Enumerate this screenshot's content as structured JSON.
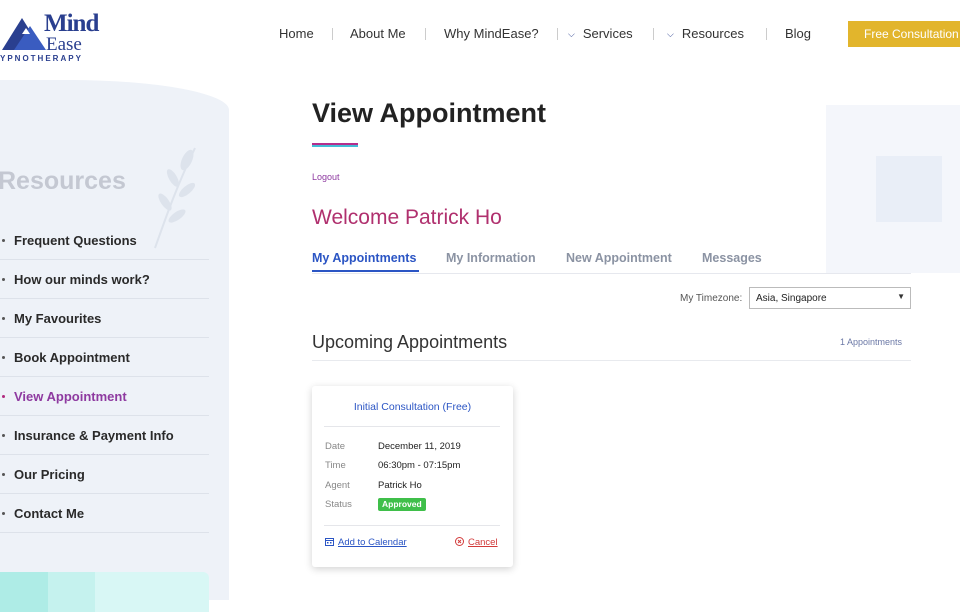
{
  "header": {
    "logo": {
      "line1": "Mind",
      "line2": "Ease",
      "tagline": "YPNOTHERAPY"
    },
    "nav": [
      {
        "label": "Home",
        "has_dropdown": false
      },
      {
        "label": "About Me",
        "has_dropdown": false
      },
      {
        "label": "Why MindEase?",
        "has_dropdown": false
      },
      {
        "label": "Services",
        "has_dropdown": true
      },
      {
        "label": "Resources",
        "has_dropdown": true
      },
      {
        "label": "Blog",
        "has_dropdown": false
      }
    ],
    "cta_label": "Free Consultation"
  },
  "sidebar": {
    "title": "Resources",
    "items": [
      {
        "label": "Frequent Questions",
        "active": false
      },
      {
        "label": "How our minds work?",
        "active": false
      },
      {
        "label": "My Favourites",
        "active": false
      },
      {
        "label": "Book Appointment",
        "active": false
      },
      {
        "label": "View Appointment",
        "active": true
      },
      {
        "label": "Insurance & Payment Info",
        "active": false
      },
      {
        "label": "Our Pricing",
        "active": false
      },
      {
        "label": "Contact Me",
        "active": false
      }
    ]
  },
  "main": {
    "title": "View Appointment",
    "logout_label": "Logout",
    "welcome": "Welcome Patrick Ho",
    "tabs": [
      {
        "label": "My Appointments",
        "active": true
      },
      {
        "label": "My Information",
        "active": false
      },
      {
        "label": "New Appointment",
        "active": false
      },
      {
        "label": "Messages",
        "active": false
      }
    ],
    "timezone": {
      "label": "My Timezone:",
      "value": "Asia, Singapore"
    },
    "upcoming": {
      "heading": "Upcoming Appointments",
      "count_label": "1 Appointments"
    },
    "appointment": {
      "title": "Initial Consultation (Free)",
      "date_label": "Date",
      "date": "December 11, 2019",
      "time_label": "Time",
      "time": "06:30pm - 07:15pm",
      "agent_label": "Agent",
      "agent": "Patrick Ho",
      "status_label": "Status",
      "status": "Approved",
      "add_calendar_label": "Add to Calendar",
      "cancel_label": "Cancel"
    }
  },
  "colors": {
    "accent_blue": "#2b55c4",
    "brand_navy": "#2a3f8f",
    "welcome_magenta": "#b0306e",
    "cta_gold": "#e2b52c",
    "status_green": "#3fbf4a",
    "cancel_red": "#d23a3a"
  },
  "icons": [
    "triangle-logo-icon",
    "chevron-down-icon",
    "leaf-icon",
    "calendar-icon",
    "cancel-circle-icon",
    "dropdown-arrow-icon"
  ]
}
